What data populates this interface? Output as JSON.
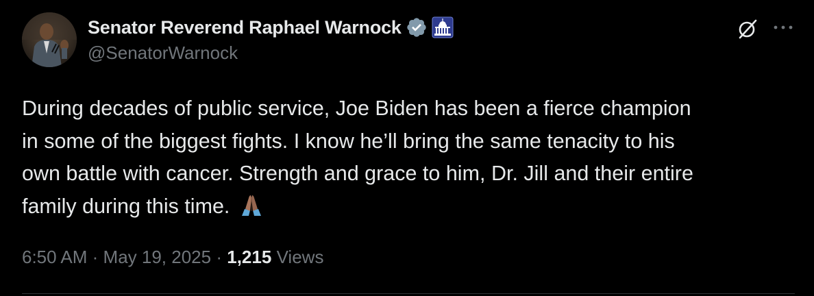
{
  "author": {
    "display_name": "Senator Reverend Raphael Warnock",
    "handle": "@SenatorWarnock",
    "avatar_icon": "person-at-podium-avatar",
    "verified_icon": "verified-badge-icon",
    "affiliation_icon": "us-capitol-badge-icon"
  },
  "tweet": {
    "text_lines": [
      "During decades of public service, Joe Biden has been a fierce champion",
      "in some of the biggest fights. I know he’ll bring the same tenacity to his",
      "own battle with cancer. Strength and grace to him, Dr. Jill and their entire",
      "family during this time."
    ],
    "emoji": "folded-hands-emoji"
  },
  "meta": {
    "time": "6:50 AM",
    "separator": "·",
    "date": "May 19, 2025",
    "views_count": "1,215",
    "views_label": "Views"
  },
  "actions": {
    "grok_icon": "grok-slash-icon",
    "more_icon": "more-options-icon"
  },
  "colors": {
    "background": "#000000",
    "primary_text": "#e7e9ea",
    "secondary_text": "#71767b",
    "verified_badge": "#829aab",
    "affiliation_badge": "#2e3b8f"
  }
}
